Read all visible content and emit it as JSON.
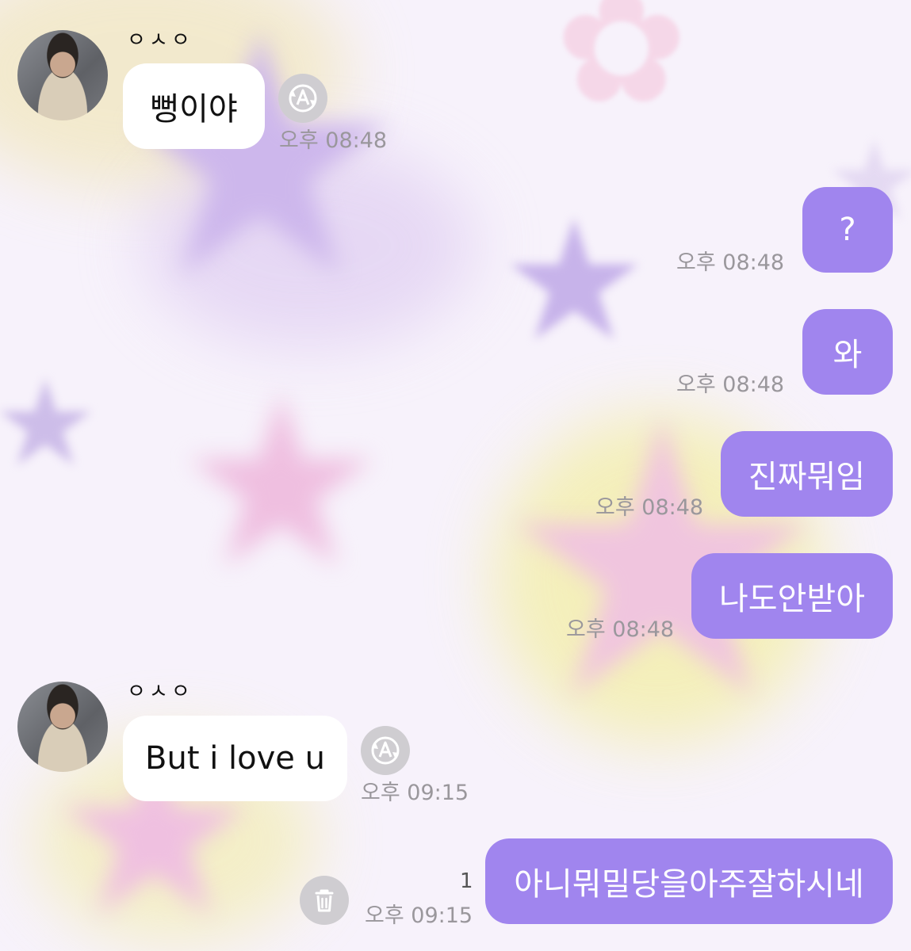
{
  "chat": {
    "contact": {
      "name": "ㅇㅅㅇ",
      "avatar_icon": "profile-photo"
    },
    "messages": [
      {
        "id": "m1",
        "direction": "in",
        "text": "뻥이야",
        "time": "오후 08:48",
        "show_sender": true,
        "action_icon": "translate-icon"
      },
      {
        "id": "m2",
        "direction": "out",
        "text": "?",
        "time": "오후 08:48"
      },
      {
        "id": "m3",
        "direction": "out",
        "text": "와",
        "time": "오후 08:48"
      },
      {
        "id": "m4",
        "direction": "out",
        "text": "진짜뭐임",
        "time": "오후 08:48"
      },
      {
        "id": "m5",
        "direction": "out",
        "text": "나도안받아",
        "time": "오후 08:48"
      },
      {
        "id": "m6",
        "direction": "in",
        "text": "But i love u",
        "time": "오후 09:15",
        "show_sender": true,
        "action_icon": "translate-icon"
      },
      {
        "id": "m7",
        "direction": "out",
        "text": "아니뭐밀당을아주잘하시네",
        "time": "오후 09:15",
        "unread_count": "1",
        "action_icon": "trash-icon"
      }
    ]
  },
  "colors": {
    "outgoing_bubble": "#a085ee",
    "incoming_bubble": "#ffffff",
    "timestamp": "#9a979c",
    "icon_circle": "#cfcdd1"
  }
}
